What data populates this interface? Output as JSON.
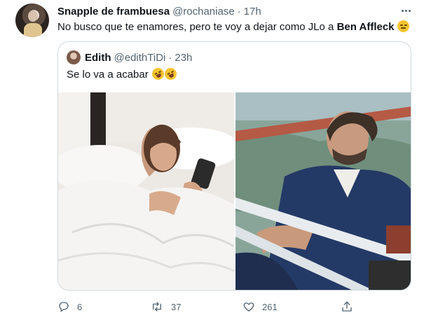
{
  "tweet": {
    "author_name": "Snapple de frambuesa",
    "author_handle": "@rochaniase",
    "separator": "·",
    "time": "17h",
    "text_before": "No busco que te enamores, pero te voy a dejar como JLo a ",
    "text_bold": "Ben Affleck",
    "text_emoji": "relieved-face-emoji",
    "more_icon": "more-icon"
  },
  "quote": {
    "author_name": "Edith",
    "author_handle": "@edithTiDi",
    "separator": "·",
    "time": "23h",
    "text": "Se lo va a acabar",
    "emojis": [
      "rolling-on-floor-laughing-emoji",
      "rolling-on-floor-laughing-emoji"
    ]
  },
  "actions": {
    "reply_count": "6",
    "retweet_count": "37",
    "like_count": "261",
    "icons": [
      "reply-icon",
      "retweet-icon",
      "like-icon",
      "share-icon"
    ]
  },
  "colors": {
    "text_primary": "#0f1419",
    "text_secondary": "#536471",
    "border": "#cfd9de",
    "background": "#ffffff"
  }
}
